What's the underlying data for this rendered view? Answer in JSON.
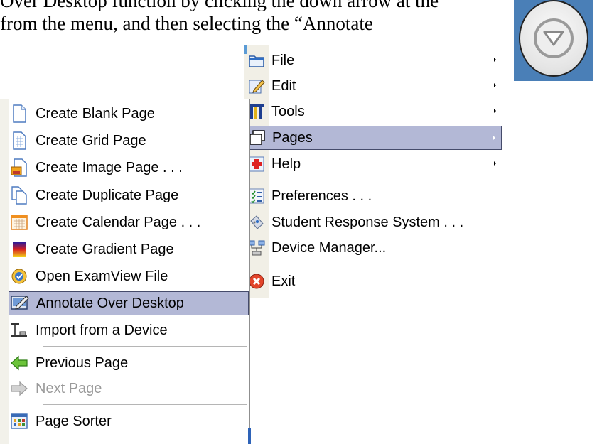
{
  "document": {
    "line1": "Over Desktop function by clicking the down arrow at the",
    "line2": "from the menu, and then selecting the “Annotate"
  },
  "dropdown_button": {
    "icon": "chevron-down-circle-icon"
  },
  "main_menu": {
    "items": [
      {
        "label": "File",
        "icon": "folder-icon",
        "submenu": true
      },
      {
        "label": "Edit",
        "icon": "edit-pencil-icon",
        "submenu": true
      },
      {
        "label": "Tools",
        "icon": "tools-icon",
        "submenu": true
      },
      {
        "label": "Pages",
        "icon": "pages-icon",
        "submenu": true,
        "highlighted": true
      },
      {
        "label": "Help",
        "icon": "help-icon",
        "submenu": true
      },
      {
        "label": "Preferences . . .",
        "icon": "preferences-icon"
      },
      {
        "label": "Student Response System . . .",
        "icon": "response-clicker-icon"
      },
      {
        "label": "Device Manager...",
        "icon": "device-manager-icon"
      },
      {
        "label": "Exit",
        "icon": "exit-icon"
      }
    ]
  },
  "pages_submenu": {
    "items": [
      {
        "label": "Create Blank Page",
        "icon": "blank-page-icon"
      },
      {
        "label": "Create Grid Page",
        "icon": "grid-page-icon"
      },
      {
        "label": "Create Image Page . . .",
        "icon": "image-page-icon"
      },
      {
        "label": "Create Duplicate Page",
        "icon": "duplicate-page-icon"
      },
      {
        "label": "Create Calendar Page . . .",
        "icon": "calendar-page-icon"
      },
      {
        "label": "Create Gradient Page",
        "icon": "gradient-page-icon"
      },
      {
        "label": "Open ExamView File",
        "icon": "examview-icon"
      },
      {
        "label": "Annotate Over Desktop",
        "icon": "annotate-desktop-icon",
        "highlighted": true
      },
      {
        "label": "Import from a Device",
        "icon": "import-device-icon"
      },
      {
        "label": "Previous Page",
        "icon": "previous-arrow-icon"
      },
      {
        "label": "Next Page",
        "icon": "next-arrow-icon",
        "disabled": true
      },
      {
        "label": "Page Sorter",
        "icon": "page-sorter-icon"
      }
    ]
  },
  "colors": {
    "highlight": "#b3b8d6",
    "highlight_border": "#454b6b",
    "disabled_text": "#9a9a9a"
  }
}
